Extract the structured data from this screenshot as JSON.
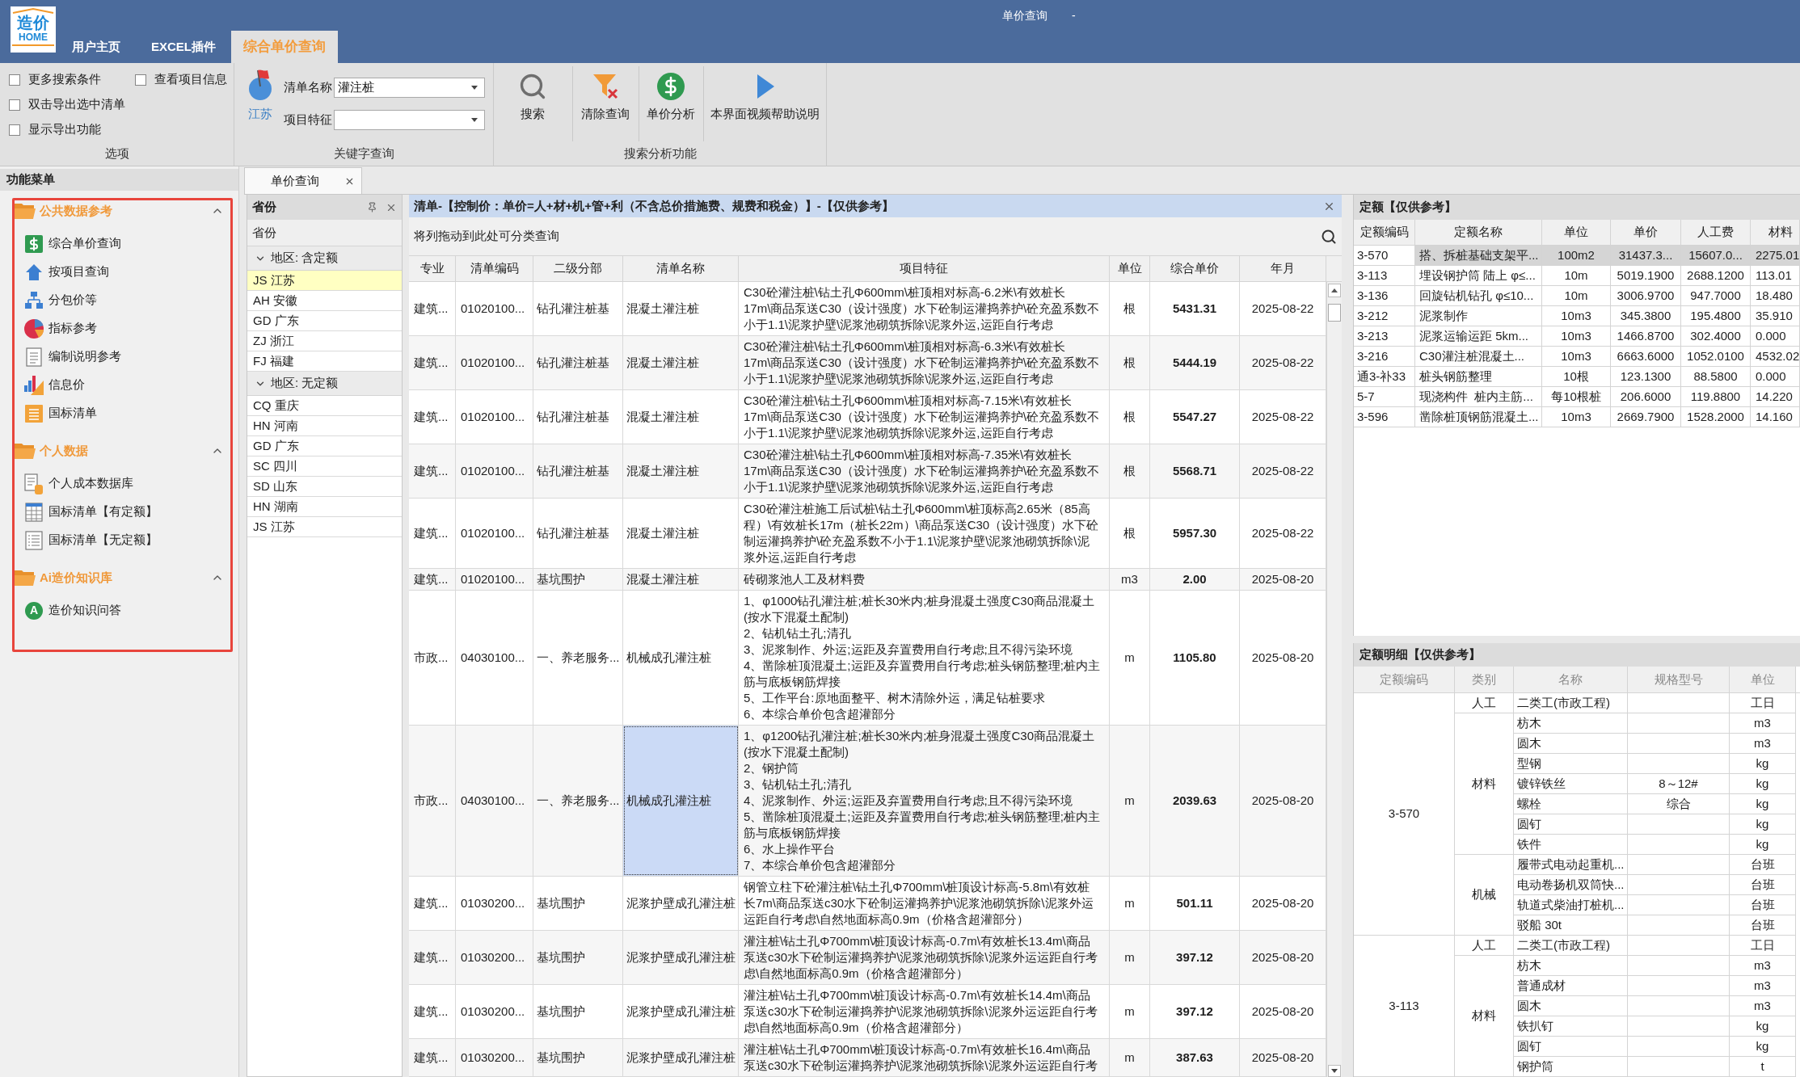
{
  "window": {
    "title": "单价查询",
    "title_suffix": "-"
  },
  "logo": {
    "text": "造价",
    "subtext": "HOME"
  },
  "tabs": [
    {
      "label": "用户主页",
      "selected": false
    },
    {
      "label": "EXCEL插件",
      "selected": false
    },
    {
      "label": "综合单价查询",
      "selected": true
    }
  ],
  "ribbon": {
    "options": {
      "label": "选项",
      "columns": [
        [
          {
            "label": "更多搜索条件",
            "checked": false
          },
          {
            "label": "双击导出选中清单",
            "checked": false
          },
          {
            "label": "显示导出功能",
            "checked": false
          }
        ],
        [
          {
            "label": "查看项目信息",
            "checked": false
          }
        ]
      ]
    },
    "keyword": {
      "label": "关键字查询",
      "region_button": "江苏",
      "fields": [
        {
          "label": "清单名称",
          "value": "灌注桩"
        },
        {
          "label": "项目特征"
        }
      ]
    },
    "search": {
      "label": "搜索分析功能",
      "buttons": [
        "搜索",
        "清除查询",
        "单价分析",
        "本界面视频帮助说明"
      ]
    }
  },
  "function_menu": {
    "title": "功能菜单",
    "sections": [
      {
        "title": "公共数据参考",
        "expanded": true,
        "items": [
          {
            "label": "综合单价查询"
          },
          {
            "label": "按项目查询"
          },
          {
            "label": "分包价等"
          },
          {
            "label": "指标参考"
          },
          {
            "label": "编制说明参考"
          },
          {
            "label": "信息价"
          },
          {
            "label": "国标清单"
          }
        ]
      },
      {
        "title": "个人数据",
        "expanded": true,
        "items": [
          {
            "label": "个人成本数据库"
          },
          {
            "label": "国标清单【有定额】"
          },
          {
            "label": "国标清单【无定额】"
          }
        ]
      },
      {
        "title": "Ai造价知识库",
        "expanded": true,
        "items": [
          {
            "label": "造价知识问答",
            "badge": "A"
          }
        ]
      }
    ]
  },
  "document_tab": {
    "label": "单价查询"
  },
  "province_panel": {
    "title": "省份",
    "column": "省份",
    "groups": [
      {
        "label": "地区: 含定额",
        "expanded": true,
        "items": [
          {
            "label": "JS 江苏",
            "selected": true
          },
          {
            "label": "AH 安徽",
            "selected": false
          },
          {
            "label": "GD 广东",
            "selected": false
          },
          {
            "label": "ZJ 浙江",
            "selected": false
          },
          {
            "label": "FJ 福建",
            "selected": false
          }
        ]
      },
      {
        "label": "地区: 无定额",
        "expanded": true,
        "items": [
          {
            "label": "CQ 重庆",
            "selected": false
          },
          {
            "label": "HN 河南",
            "selected": false
          },
          {
            "label": "GD 广东",
            "selected": false
          },
          {
            "label": "SC 四川",
            "selected": false
          },
          {
            "label": "SD 山东",
            "selected": false
          },
          {
            "label": "HN 湖南",
            "selected": false
          },
          {
            "label": "JS 江苏",
            "selected": false
          }
        ]
      }
    ]
  },
  "list_table": {
    "title": "清单-【控制价：单价=人+材+机+管+利（不含总价措施费、规费和税金）】-【仅供参考】",
    "group_hint": "将列拖动到此处可分类查询",
    "columns": [
      "专业",
      "清单编码",
      "二级分部",
      "清单名称",
      "项目特征",
      "单位",
      "综合单价",
      "年月"
    ],
    "rows": [
      {
        "specialty": "建筑...",
        "code": "01020100...",
        "division": "钻孔灌注桩基",
        "name": "混凝土灌注桩",
        "features": "C30砼灌注桩\\钻土孔Φ600mm\\桩顶相对标高-6.2米\\有效桩长17m\\商品泵送C30（设计强度）水下砼制运灌捣养护\\砼充盈系数不小于1.1\\泥浆护壁\\泥浆池砌筑拆除\\泥浆外运,运距自行考虑",
        "unit": "根",
        "price": "5431.31",
        "date": "2025-08-22",
        "selected": false
      },
      {
        "specialty": "建筑...",
        "code": "01020100...",
        "division": "钻孔灌注桩基",
        "name": "混凝土灌注桩",
        "features": "C30砼灌注桩\\钻土孔Φ600mm\\桩顶相对标高-6.3米\\有效桩长17m\\商品泵送C30（设计强度）水下砼制运灌捣养护\\砼充盈系数不小于1.1\\泥浆护壁\\泥浆池砌筑拆除\\泥浆外运,运距自行考虑",
        "unit": "根",
        "price": "5444.19",
        "date": "2025-08-22",
        "selected": false
      },
      {
        "specialty": "建筑...",
        "code": "01020100...",
        "division": "钻孔灌注桩基",
        "name": "混凝土灌注桩",
        "features": "C30砼灌注桩\\钻土孔Φ600mm\\桩顶相对标高-7.15米\\有效桩长17m\\商品泵送C30（设计强度）水下砼制运灌捣养护\\砼充盈系数不小于1.1\\泥浆护壁\\泥浆池砌筑拆除\\泥浆外运,运距自行考虑",
        "unit": "根",
        "price": "5547.27",
        "date": "2025-08-22",
        "selected": false
      },
      {
        "specialty": "建筑...",
        "code": "01020100...",
        "division": "钻孔灌注桩基",
        "name": "混凝土灌注桩",
        "features": "C30砼灌注桩\\钻土孔Φ600mm\\桩顶相对标高-7.35米\\有效桩长17m\\商品泵送C30（设计强度）水下砼制运灌捣养护\\砼充盈系数不小于1.1\\泥浆护壁\\泥浆池砌筑拆除\\泥浆外运,运距自行考虑",
        "unit": "根",
        "price": "5568.71",
        "date": "2025-08-22",
        "selected": false
      },
      {
        "specialty": "建筑...",
        "code": "01020100...",
        "division": "钻孔灌注桩基",
        "name": "混凝土灌注桩",
        "features": "C30砼灌注桩施工后试桩\\钻土孔Φ600mm\\桩顶标高2.65米（85高程）\\有效桩长17m（桩长22m）\\商品泵送C30（设计强度）水下砼制运灌捣养护\\砼充盈系数不小于1.1\\泥浆护壁\\泥浆池砌筑拆除\\泥浆外运,运距自行考虑",
        "unit": "根",
        "price": "5957.30",
        "date": "2025-08-22",
        "selected": false
      },
      {
        "specialty": "建筑...",
        "code": "01020100...",
        "division": "基坑围护",
        "name": "混凝土灌注桩",
        "features": "砖砌浆池人工及材料费",
        "unit": "m3",
        "price": "2.00",
        "date": "2025-08-20",
        "selected": false
      },
      {
        "specialty": "市政...",
        "code": "04030100...",
        "division": "一、养老服务...",
        "name": "机械成孔灌注桩",
        "features": "1、φ1000钻孔灌注桩;桩长30米内;桩身混凝土强度C30商品混凝土(按水下混凝土配制)\n2、钻机钻土孔;清孔\n3、泥浆制作、外运;运距及弃置费用自行考虑;且不得污染环境\n4、凿除桩顶混凝土;运距及弃置费用自行考虑;桩头钢筋整理;桩内主筋与底板钢筋焊接\n5、工作平台:原地面整平、树木清除外运，满足钻桩要求\n6、本综合单价包含超灌部分",
        "unit": "m",
        "price": "1105.80",
        "date": "2025-08-20",
        "selected": false
      },
      {
        "specialty": "市政...",
        "code": "04030100...",
        "division": "一、养老服务...",
        "name": "机械成孔灌注桩",
        "features": "1、φ1200钻孔灌注桩;桩长30米内;桩身混凝土强度C30商品混凝土(按水下混凝土配制)\n2、钢护筒\n3、钻机钻土孔;清孔\n4、泥浆制作、外运;运距及弃置费用自行考虑;且不得污染环境\n5、凿除桩顶混凝土;运距及弃置费用自行考虑;桩头钢筋整理;桩内主筋与底板钢筋焊接\n6、水上操作平台\n7、本综合单价包含超灌部分",
        "unit": "m",
        "price": "2039.63",
        "date": "2025-08-20",
        "selected": true
      },
      {
        "specialty": "建筑...",
        "code": "01030200...",
        "division": "基坑围护",
        "name": "泥浆护壁成孔灌注桩",
        "features": "钢管立柱下砼灌注桩\\钻土孔Φ700mm\\桩顶设计标高-5.8m\\有效桩长7m\\商品泵送c30水下砼制运灌捣养护\\泥浆池砌筑拆除\\泥浆外运运距自行考虑\\自然地面标高0.9m（价格含超灌部分）",
        "unit": "m",
        "price": "501.11",
        "date": "2025-08-20",
        "selected": false
      },
      {
        "specialty": "建筑...",
        "code": "01030200...",
        "division": "基坑围护",
        "name": "泥浆护壁成孔灌注桩",
        "features": "灌注桩\\钻土孔Φ700mm\\桩顶设计标高-0.7m\\有效桩长13.4m\\商品泵送c30水下砼制运灌捣养护\\泥浆池砌筑拆除\\泥浆外运运距自行考虑\\自然地面标高0.9m（价格含超灌部分）",
        "unit": "m",
        "price": "397.12",
        "date": "2025-08-20",
        "selected": false
      },
      {
        "specialty": "建筑...",
        "code": "01030200...",
        "division": "基坑围护",
        "name": "泥浆护壁成孔灌注桩",
        "features": "灌注桩\\钻土孔Φ700mm\\桩顶设计标高-0.7m\\有效桩长14.4m\\商品泵送c30水下砼制运灌捣养护\\泥浆池砌筑拆除\\泥浆外运运距自行考虑\\自然地面标高0.9m（价格含超灌部分）",
        "unit": "m",
        "price": "397.12",
        "date": "2025-08-20",
        "selected": false
      },
      {
        "specialty": "建筑...",
        "code": "01030200...",
        "division": "基坑围护",
        "name": "泥浆护壁成孔灌注桩",
        "features": "灌注桩\\钻土孔Φ700mm\\桩顶设计标高-0.7m\\有效桩长16.4m\\商品泵送c30水下砼制运灌捣养护\\泥浆池砌筑拆除\\泥浆外运运距自行考",
        "unit": "m",
        "price": "387.63",
        "date": "2025-08-20",
        "selected": false
      }
    ]
  },
  "quota_table": {
    "title": "定额【仅供参考】",
    "columns": [
      "定额编码",
      "定额名称",
      "单位",
      "单价",
      "人工费",
      "材料"
    ],
    "rows": [
      {
        "cells": [
          "3-570",
          "搭、拆桩基础支架平...",
          "100m2",
          "31437.3...",
          "15607.0...",
          "2275.01"
        ],
        "selected": true
      },
      {
        "cells": [
          "3-113",
          "埋设钢护筒 陆上 φ≤...",
          "10m",
          "5019.1900",
          "2688.1200",
          "113.01"
        ],
        "selected": false
      },
      {
        "cells": [
          "3-136",
          "回旋钻机钻孔 φ≤10...",
          "10m",
          "3006.9700",
          "947.7000",
          "18.480"
        ],
        "selected": false
      },
      {
        "cells": [
          "3-212",
          "泥浆制作",
          "10m3",
          "345.3800",
          "195.4800",
          "35.910"
        ],
        "selected": false
      },
      {
        "cells": [
          "3-213",
          "泥浆运输运距 5km...",
          "10m3",
          "1466.8700",
          "302.4000",
          "0.000"
        ],
        "selected": false
      },
      {
        "cells": [
          "3-216",
          "C30灌注桩混凝土...",
          "10m3",
          "6663.6000",
          "1052.0100",
          "4532.02"
        ],
        "selected": false
      },
      {
        "cells": [
          "通3-补33",
          "桩头钢筋整理",
          "10根",
          "123.1300",
          "88.5800",
          "0.000"
        ],
        "selected": false
      },
      {
        "cells": [
          "5-7",
          "现浇构件  桩内主筋...",
          "每10根桩",
          "206.6000",
          "119.8800",
          "14.220"
        ],
        "selected": false
      },
      {
        "cells": [
          "3-596",
          "凿除桩顶钢筋混凝土...",
          "10m3",
          "2669.7900",
          "1528.2000",
          "14.160"
        ],
        "selected": false
      }
    ]
  },
  "quota_detail": {
    "title": "定额明细【仅供参考】",
    "columns": [
      "定额编码",
      "类别",
      "名称",
      "规格型号",
      "单位"
    ],
    "groups": [
      {
        "code": "3-570",
        "categories": [
          {
            "category": "人工",
            "items": [
              {
                "name": "二类工(市政工程)",
                "unit": "工日"
              }
            ]
          },
          {
            "category": "材料",
            "items": [
              {
                "name": "枋木",
                "unit": "m3"
              },
              {
                "name": "圆木",
                "unit": "m3"
              },
              {
                "name": "型钢",
                "unit": "kg"
              },
              {
                "name": "镀锌铁丝",
                "spec": "8～12#",
                "unit": "kg"
              },
              {
                "name": "螺栓",
                "spec": "综合",
                "unit": "kg"
              },
              {
                "name": "圆钉",
                "unit": "kg"
              },
              {
                "name": "铁件",
                "unit": "kg"
              }
            ]
          },
          {
            "category": "机械",
            "items": [
              {
                "name": "履带式电动起重机...",
                "unit": "台班"
              },
              {
                "name": "电动卷扬机双筒快...",
                "unit": "台班"
              },
              {
                "name": "轨道式柴油打桩机...",
                "unit": "台班"
              },
              {
                "name": "驳船 30t",
                "unit": "台班"
              }
            ]
          }
        ]
      },
      {
        "code": "3-113",
        "categories": [
          {
            "category": "人工",
            "items": [
              {
                "name": "二类工(市政工程)",
                "unit": "工日"
              }
            ]
          },
          {
            "category": "材料",
            "items": [
              {
                "name": "枋木",
                "unit": "m3"
              },
              {
                "name": "普通成材",
                "unit": "m3"
              },
              {
                "name": "圆木",
                "unit": "m3"
              },
              {
                "name": "铁扒钉",
                "unit": "kg"
              },
              {
                "name": "圆钉",
                "unit": "kg"
              },
              {
                "name": "钢护筒",
                "unit": "t"
              }
            ]
          }
        ]
      }
    ]
  }
}
